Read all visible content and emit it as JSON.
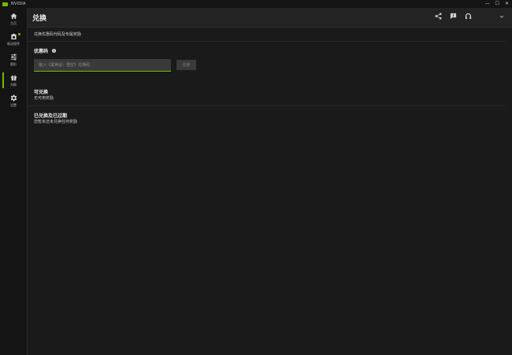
{
  "titlebar": {
    "app_name": "NVIDIA",
    "controls": [
      "—",
      "☐",
      "✕"
    ]
  },
  "sidebar": {
    "items": [
      {
        "label": "主页",
        "icon": "home-icon"
      },
      {
        "label": "驱动程序",
        "icon": "driver-icon",
        "badge": true
      },
      {
        "label": "图形",
        "icon": "graphics-sliders-icon"
      },
      {
        "label": "兑换",
        "icon": "gift-icon",
        "active": true
      },
      {
        "label": "设置",
        "icon": "gear-icon"
      }
    ]
  },
  "header": {
    "title": "兑换",
    "icons": [
      "share-icon",
      "feedback-icon",
      "user-icon",
      "chevron-down-icon"
    ]
  },
  "main": {
    "subtitle": "兑换优惠码代码及专属奖励",
    "promo": {
      "label": "优惠码",
      "placeholder": "输入《黑神话：悟空》兑换码",
      "redeem_label": "兑换"
    },
    "available": {
      "title": "可兑换",
      "subtitle": "无可用奖励"
    },
    "redeemed": {
      "title": "已兑换及已过期",
      "subtitle": "您暂未还未兑换任何奖励"
    }
  },
  "colors": {
    "accent": "#76b900",
    "background": "#1a1a1a",
    "sidebar": "#141414",
    "header": "#232323"
  }
}
